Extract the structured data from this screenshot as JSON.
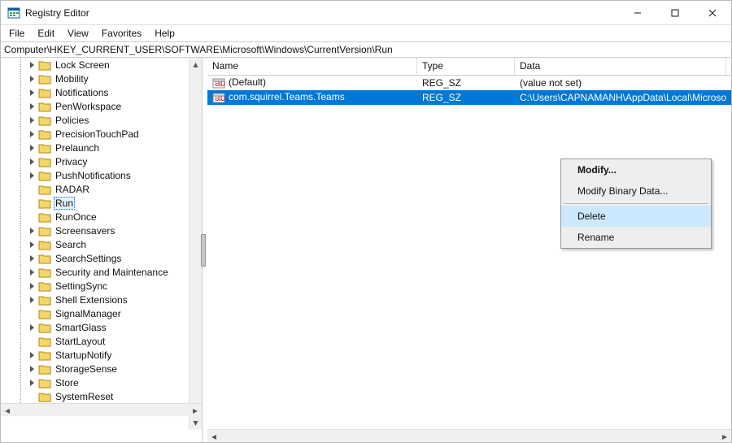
{
  "window": {
    "title": "Registry Editor"
  },
  "win_controls": {
    "min": "–",
    "max": "□",
    "close": "✕"
  },
  "menus": [
    "File",
    "Edit",
    "View",
    "Favorites",
    "Help"
  ],
  "breadcrumb": "Computer\\HKEY_CURRENT_USER\\SOFTWARE\\Microsoft\\Windows\\CurrentVersion\\Run",
  "tree": {
    "selected": "Run",
    "items": [
      {
        "label": "Lock Screen",
        "exp": ">"
      },
      {
        "label": "Mobility",
        "exp": ">"
      },
      {
        "label": "Notifications",
        "exp": ">"
      },
      {
        "label": "PenWorkspace",
        "exp": ">"
      },
      {
        "label": "Policies",
        "exp": ">"
      },
      {
        "label": "PrecisionTouchPad",
        "exp": ">"
      },
      {
        "label": "Prelaunch",
        "exp": ">"
      },
      {
        "label": "Privacy",
        "exp": ">"
      },
      {
        "label": "PushNotifications",
        "exp": ">"
      },
      {
        "label": "RADAR",
        "exp": ""
      },
      {
        "label": "Run",
        "exp": "",
        "selected": true
      },
      {
        "label": "RunOnce",
        "exp": ""
      },
      {
        "label": "Screensavers",
        "exp": ">"
      },
      {
        "label": "Search",
        "exp": ">"
      },
      {
        "label": "SearchSettings",
        "exp": ">"
      },
      {
        "label": "Security and Maintenance",
        "exp": ">"
      },
      {
        "label": "SettingSync",
        "exp": ">"
      },
      {
        "label": "Shell Extensions",
        "exp": ">"
      },
      {
        "label": "SignalManager",
        "exp": ""
      },
      {
        "label": "SmartGlass",
        "exp": ">"
      },
      {
        "label": "StartLayout",
        "exp": ""
      },
      {
        "label": "StartupNotify",
        "exp": ">"
      },
      {
        "label": "StorageSense",
        "exp": ">"
      },
      {
        "label": "Store",
        "exp": ">"
      },
      {
        "label": "SystemReset",
        "exp": ""
      }
    ]
  },
  "list": {
    "columns": {
      "name": "Name",
      "type": "Type",
      "data": "Data"
    },
    "rows": [
      {
        "name": "(Default)",
        "type": "REG_SZ",
        "data": "(value not set)",
        "selected": false
      },
      {
        "name": "com.squirrel.Teams.Teams",
        "type": "REG_SZ",
        "data": "C:\\Users\\CAPNAMANH\\AppData\\Local\\Microsoft.",
        "selected": true
      }
    ]
  },
  "context_menu": {
    "items": [
      {
        "label": "Modify...",
        "emph": true
      },
      {
        "label": "Modify Binary Data..."
      },
      {
        "sep": true
      },
      {
        "label": "Delete",
        "hover": true
      },
      {
        "label": "Rename"
      }
    ]
  },
  "status": {
    "left_l": "<",
    "left_r": ">",
    "right_l": "<",
    "right_r": ">"
  }
}
